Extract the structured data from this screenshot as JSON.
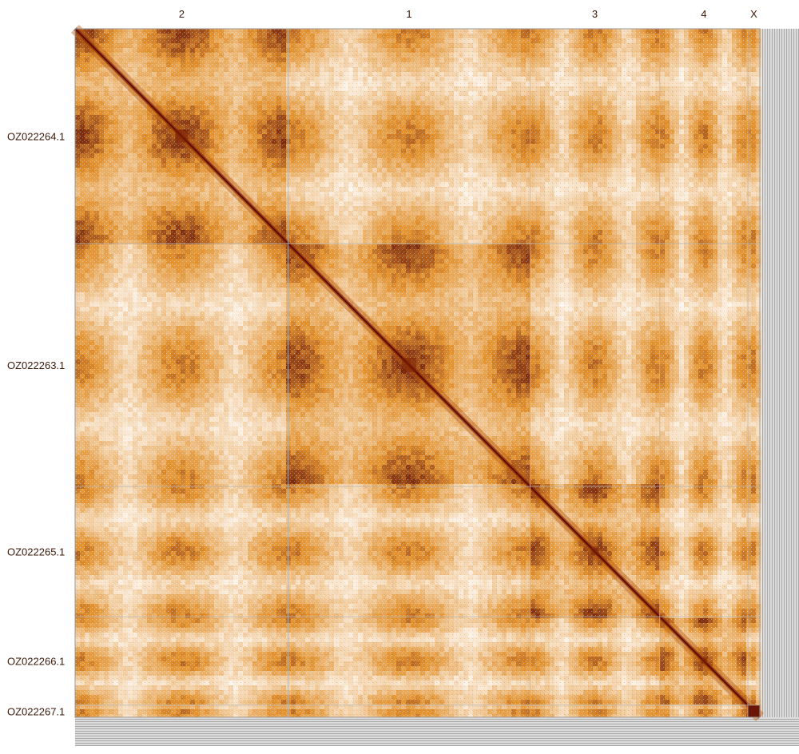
{
  "chart_data": {
    "type": "heatmap",
    "title": "",
    "x_axis": {
      "position": "top",
      "labels": [
        "2",
        "1",
        "3",
        "4",
        "X"
      ]
    },
    "y_axis": {
      "position": "left",
      "labels": [
        "OZ022264.1",
        "OZ022263.1",
        "OZ022265.1",
        "OZ022266.1",
        "OZ022267.1"
      ]
    },
    "x_blocks": [
      {
        "label": "2",
        "relative_length": 266
      },
      {
        "label": "1",
        "relative_length": 302
      },
      {
        "label": "3",
        "relative_length": 162
      },
      {
        "label": "4",
        "relative_length": 110
      },
      {
        "label": "X",
        "relative_length": 15
      }
    ],
    "y_blocks": [
      {
        "label": "OZ022264.1",
        "relative_length": 267
      },
      {
        "label": "OZ022263.1",
        "relative_length": 302
      },
      {
        "label": "OZ022265.1",
        "relative_length": 162
      },
      {
        "label": "OZ022266.1",
        "relative_length": 110
      },
      {
        "label": "OZ022267.1",
        "relative_length": 15
      }
    ],
    "grid": true,
    "colors": {
      "low": "#ffffff",
      "mid": "#e2922f",
      "high": "#5a0a05",
      "grid": "#b8b8b8",
      "unplaced": "#c8c8c8"
    }
  }
}
